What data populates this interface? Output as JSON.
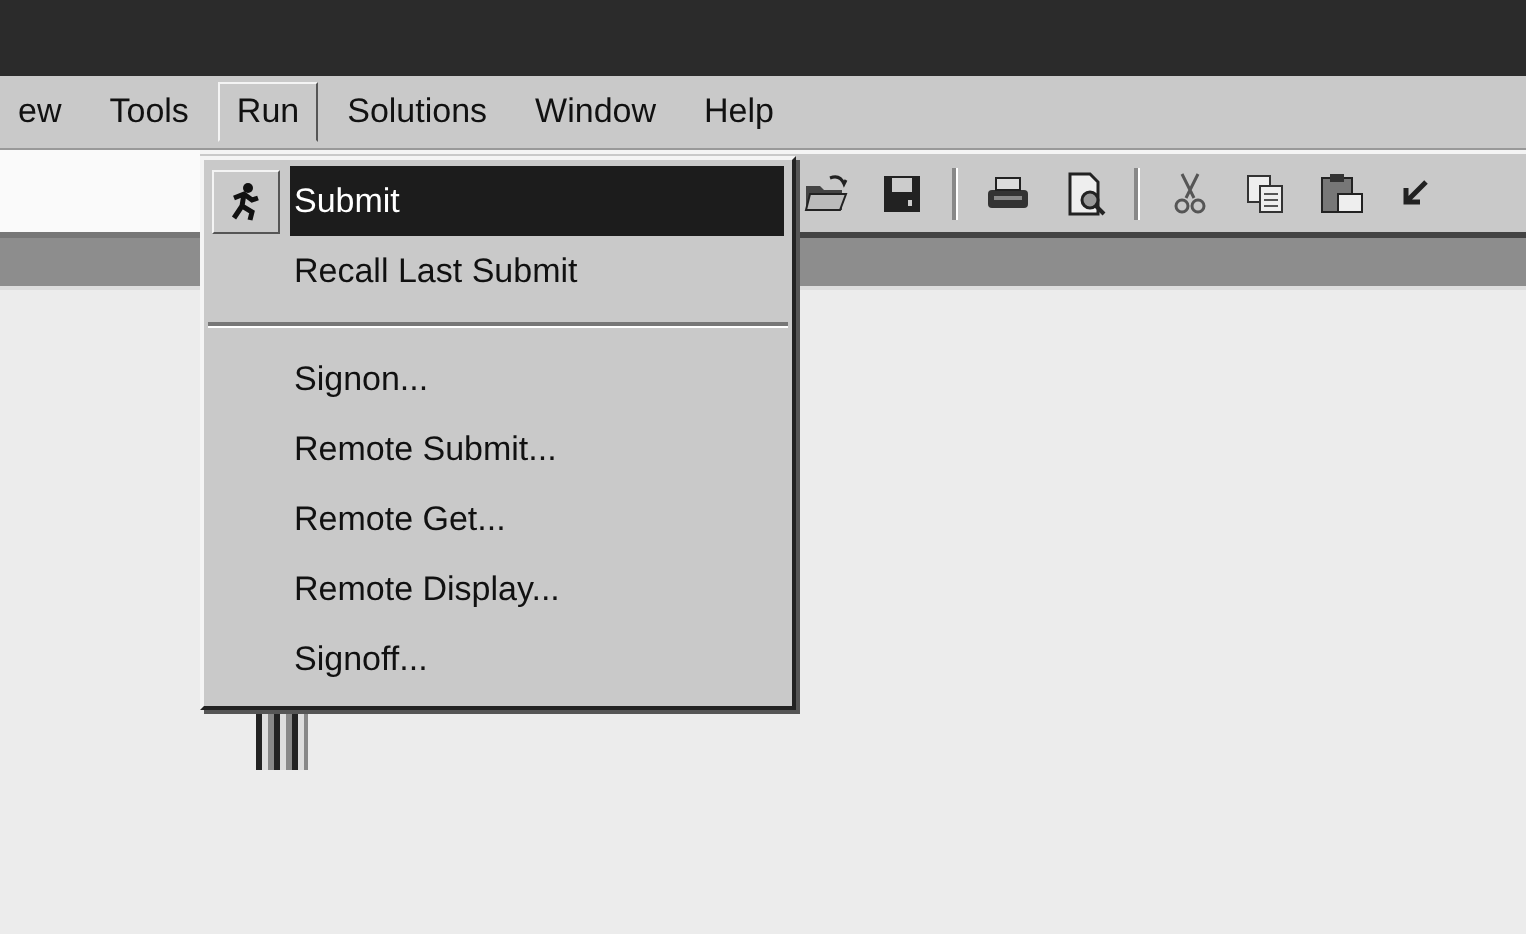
{
  "menu_bar": [
    {
      "label": "ew",
      "selected": false
    },
    {
      "label": "Tools",
      "selected": false
    },
    {
      "label": "Run",
      "selected": true
    },
    {
      "label": "Solutions",
      "selected": false
    },
    {
      "label": "Window",
      "selected": false
    },
    {
      "label": "Help",
      "selected": false
    }
  ],
  "toolbar": [
    {
      "kind": "open"
    },
    {
      "kind": "save"
    },
    {
      "kind": "separator"
    },
    {
      "kind": "print"
    },
    {
      "kind": "preview"
    },
    {
      "kind": "separator"
    },
    {
      "kind": "cut"
    },
    {
      "kind": "copy"
    },
    {
      "kind": "paste"
    },
    {
      "kind": "undo"
    }
  ],
  "run_menu": [
    {
      "kind": "icon_item",
      "label": "Submit",
      "selected": true
    },
    {
      "kind": "item",
      "label": "Recall Last Submit",
      "selected": false
    },
    {
      "kind": "separator"
    },
    {
      "kind": "item",
      "label": "Signon...",
      "selected": false
    },
    {
      "kind": "item",
      "label": "Remote Submit...",
      "selected": false
    },
    {
      "kind": "item",
      "label": "Remote Get...",
      "selected": false
    },
    {
      "kind": "item",
      "label": "Remote Display...",
      "selected": false
    },
    {
      "kind": "item",
      "label": "Signoff...",
      "selected": false
    }
  ]
}
